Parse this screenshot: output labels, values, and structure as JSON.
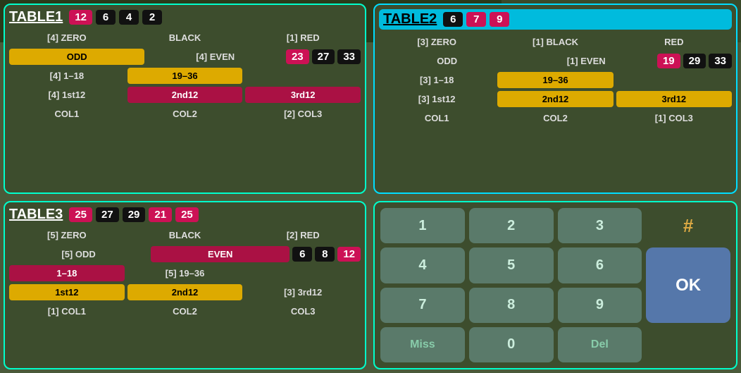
{
  "toolbar": {
    "back_label": "↩",
    "wrench_label": "🔧",
    "save_label": "💾",
    "info_label": "ℹ",
    "close_label": "✕"
  },
  "table1": {
    "title": "TABLE1",
    "badges": [
      {
        "value": "12",
        "type": "red"
      },
      {
        "value": "6",
        "type": "black"
      },
      {
        "value": "4",
        "type": "black"
      },
      {
        "value": "2",
        "type": "black"
      }
    ],
    "rows": [
      [
        {
          "text": "[4] ZERO",
          "style": "transparent"
        },
        {
          "text": "BLACK",
          "style": "transparent"
        },
        {
          "text": "[1] RED",
          "style": "transparent"
        }
      ],
      [
        {
          "text": "ODD",
          "style": "yellow"
        },
        {
          "text": "[4] EVEN",
          "style": "transparent"
        },
        {
          "text": "23  27  33",
          "style": "multi-badge"
        }
      ],
      [
        {
          "text": "[4] 1-18",
          "style": "transparent"
        },
        {
          "text": "19-36",
          "style": "yellow"
        },
        {
          "text": "",
          "style": "empty"
        }
      ],
      [
        {
          "text": "[4] 1st12",
          "style": "transparent"
        },
        {
          "text": "2nd12",
          "style": "crimson"
        },
        {
          "text": "3rd12",
          "style": "crimson"
        }
      ],
      [
        {
          "text": "COL1",
          "style": "transparent"
        },
        {
          "text": "COL2",
          "style": "transparent"
        },
        {
          "text": "[2] COL3",
          "style": "transparent"
        }
      ]
    ],
    "num_badges_row3": [
      "23",
      "27",
      "33"
    ]
  },
  "table2": {
    "title": "TABLE2",
    "badges": [
      {
        "value": "6",
        "type": "black"
      },
      {
        "value": "7",
        "type": "red"
      },
      {
        "value": "9",
        "type": "red"
      }
    ],
    "header_bg": "cyan",
    "rows": [
      [
        {
          "text": "[3] ZERO",
          "style": "transparent"
        },
        {
          "text": "[1] BLACK",
          "style": "transparent"
        },
        {
          "text": "RED",
          "style": "transparent"
        }
      ],
      [
        {
          "text": "ODD",
          "style": "transparent"
        },
        {
          "text": "[1] EVEN",
          "style": "transparent"
        },
        {
          "text": "19  29  33",
          "style": "multi-badge"
        }
      ],
      [
        {
          "text": "[3] 1-18",
          "style": "transparent"
        },
        {
          "text": "19-36",
          "style": "yellow"
        },
        {
          "text": "",
          "style": "empty"
        }
      ],
      [
        {
          "text": "[3] 1st12",
          "style": "transparent"
        },
        {
          "text": "2nd12",
          "style": "yellow"
        },
        {
          "text": "3rd12",
          "style": "yellow"
        }
      ],
      [
        {
          "text": "COL1",
          "style": "transparent"
        },
        {
          "text": "COL2",
          "style": "transparent"
        },
        {
          "text": "[1] COL3",
          "style": "transparent"
        }
      ]
    ],
    "num_badges_row3": [
      "19",
      "29",
      "33"
    ]
  },
  "table3": {
    "title": "TABLE3",
    "badges": [
      {
        "value": "25",
        "type": "red"
      },
      {
        "value": "27",
        "type": "black"
      },
      {
        "value": "29",
        "type": "black"
      },
      {
        "value": "21",
        "type": "red"
      },
      {
        "value": "25",
        "type": "red"
      }
    ],
    "rows": [
      [
        {
          "text": "[5] ZERO",
          "style": "transparent"
        },
        {
          "text": "BLACK",
          "style": "transparent"
        },
        {
          "text": "[2] RED",
          "style": "transparent"
        }
      ],
      [
        {
          "text": "[5] ODD",
          "style": "transparent"
        },
        {
          "text": "EVEN",
          "style": "crimson"
        },
        {
          "text": "6  8  12",
          "style": "multi-badge"
        }
      ],
      [
        {
          "text": "1-18",
          "style": "crimson"
        },
        {
          "text": "[5] 19-36",
          "style": "transparent"
        },
        {
          "text": "",
          "style": "empty"
        }
      ],
      [
        {
          "text": "1st12",
          "style": "yellow"
        },
        {
          "text": "2nd12",
          "style": "yellow"
        },
        {
          "text": "[3] 3rd12",
          "style": "transparent"
        }
      ],
      [
        {
          "text": "[1] COL1",
          "style": "transparent"
        },
        {
          "text": "COL2",
          "style": "transparent"
        },
        {
          "text": "COL3",
          "style": "transparent"
        }
      ]
    ],
    "num_badges_row3": [
      "6",
      "8",
      "12"
    ]
  },
  "numpad": {
    "keys": [
      "1",
      "2",
      "3",
      "4",
      "5",
      "6",
      "7",
      "8",
      "9",
      "Miss",
      "0",
      "Del"
    ],
    "hash": "#",
    "ok": "OK"
  }
}
